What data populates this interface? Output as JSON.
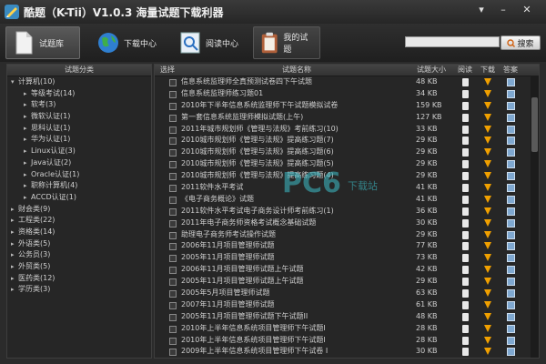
{
  "app": {
    "title": "酷题（K-Tii）V1.0.3 海量试题下载利器"
  },
  "toolbar": {
    "tabs": [
      {
        "label": "试题库",
        "icon": "document-icon"
      },
      {
        "label": "下载中心",
        "icon": "globe-icon"
      },
      {
        "label": "阅读中心",
        "icon": "magnifier-icon"
      },
      {
        "label": "我的试题",
        "icon": "clipboard-icon"
      }
    ]
  },
  "search": {
    "placeholder": "",
    "button_label": "搜索"
  },
  "left_panel": {
    "header": "试题分类",
    "items": [
      {
        "label": "计算机(10)",
        "expanded": true,
        "level": 0
      },
      {
        "label": "等级考试(14)",
        "level": 1
      },
      {
        "label": "软考(3)",
        "level": 1
      },
      {
        "label": "微软认证(1)",
        "level": 1
      },
      {
        "label": "思科认证(1)",
        "level": 1
      },
      {
        "label": "华为认证(1)",
        "level": 1
      },
      {
        "label": "Linux认证(3)",
        "level": 1
      },
      {
        "label": "Java认证(2)",
        "level": 1
      },
      {
        "label": "Oracle认证(1)",
        "level": 1
      },
      {
        "label": "职称计算机(4)",
        "level": 1
      },
      {
        "label": "ACCD认证(1)",
        "level": 1
      },
      {
        "label": "财会类(9)",
        "level": 0
      },
      {
        "label": "工程类(22)",
        "level": 0
      },
      {
        "label": "资格类(14)",
        "level": 0
      },
      {
        "label": "外语类(5)",
        "level": 0
      },
      {
        "label": "公务员(3)",
        "level": 0
      },
      {
        "label": "外贸类(5)",
        "level": 0
      },
      {
        "label": "医药类(12)",
        "level": 0
      },
      {
        "label": "学历类(3)",
        "level": 0
      }
    ]
  },
  "table": {
    "headers": {
      "select": "选择",
      "name": "试题名称",
      "size": "试题大小",
      "read": "阅读",
      "download": "下载",
      "answer": "答案"
    },
    "rows": [
      {
        "name": "信息系统监理师全真预测试卷四下午试题",
        "size": "48 KB"
      },
      {
        "name": "信息系统监理师练习题01",
        "size": "34 KB"
      },
      {
        "name": "2010年下半年信息系统监理师下午试题模拟试卷",
        "size": "159 KB"
      },
      {
        "name": "第一套信息系统监理师模拟试题(上午)",
        "size": "127 KB"
      },
      {
        "name": "2011年城市规划师《管理与法规》考前练习(10)",
        "size": "33 KB"
      },
      {
        "name": "2010城市规划师《管理与法规》提高练习题(7)",
        "size": "29 KB"
      },
      {
        "name": "2010城市规划师《管理与法规》提高练习题(6)",
        "size": "29 KB"
      },
      {
        "name": "2010城市规划师《管理与法规》提高练习题(5)",
        "size": "29 KB"
      },
      {
        "name": "2010城市规划师《管理与法规》提高练习题(4)",
        "size": "29 KB"
      },
      {
        "name": "2011软件水平考试",
        "size": "41 KB"
      },
      {
        "name": "《电子商务概论》试题",
        "size": "41 KB"
      },
      {
        "name": "2011软件水平考试电子商务设计师考前练习(1)",
        "size": "36 KB"
      },
      {
        "name": "2011年电子商务师资格考试概念基础试题",
        "size": "30 KB"
      },
      {
        "name": "助理电子商务师考试操作试题",
        "size": "29 KB"
      },
      {
        "name": "2006年11月项目管理师试题",
        "size": "77 KB"
      },
      {
        "name": "2005年11月项目管理师试题",
        "size": "73 KB"
      },
      {
        "name": "2006年11月项目管理师试题上午试题",
        "size": "42 KB"
      },
      {
        "name": "2005年11月项目管理师试题上午试题",
        "size": "29 KB"
      },
      {
        "name": "2005年5月项目管理师试题",
        "size": "63 KB"
      },
      {
        "name": "2007年11月项目管理师试题",
        "size": "61 KB"
      },
      {
        "name": "2005年11月项目管理师试题下午试题II",
        "size": "48 KB"
      },
      {
        "name": "2010年上半年信息系统项目管理师下午试题I",
        "size": "28 KB"
      },
      {
        "name": "2010年上半年信息系统项目管理师下午试题I",
        "size": "28 KB"
      },
      {
        "name": "2009年上半年信息系统项目管理师下午试卷 I",
        "size": "30 KB"
      }
    ]
  },
  "watermark": {
    "main": "PC6",
    "sub": "下载站"
  }
}
